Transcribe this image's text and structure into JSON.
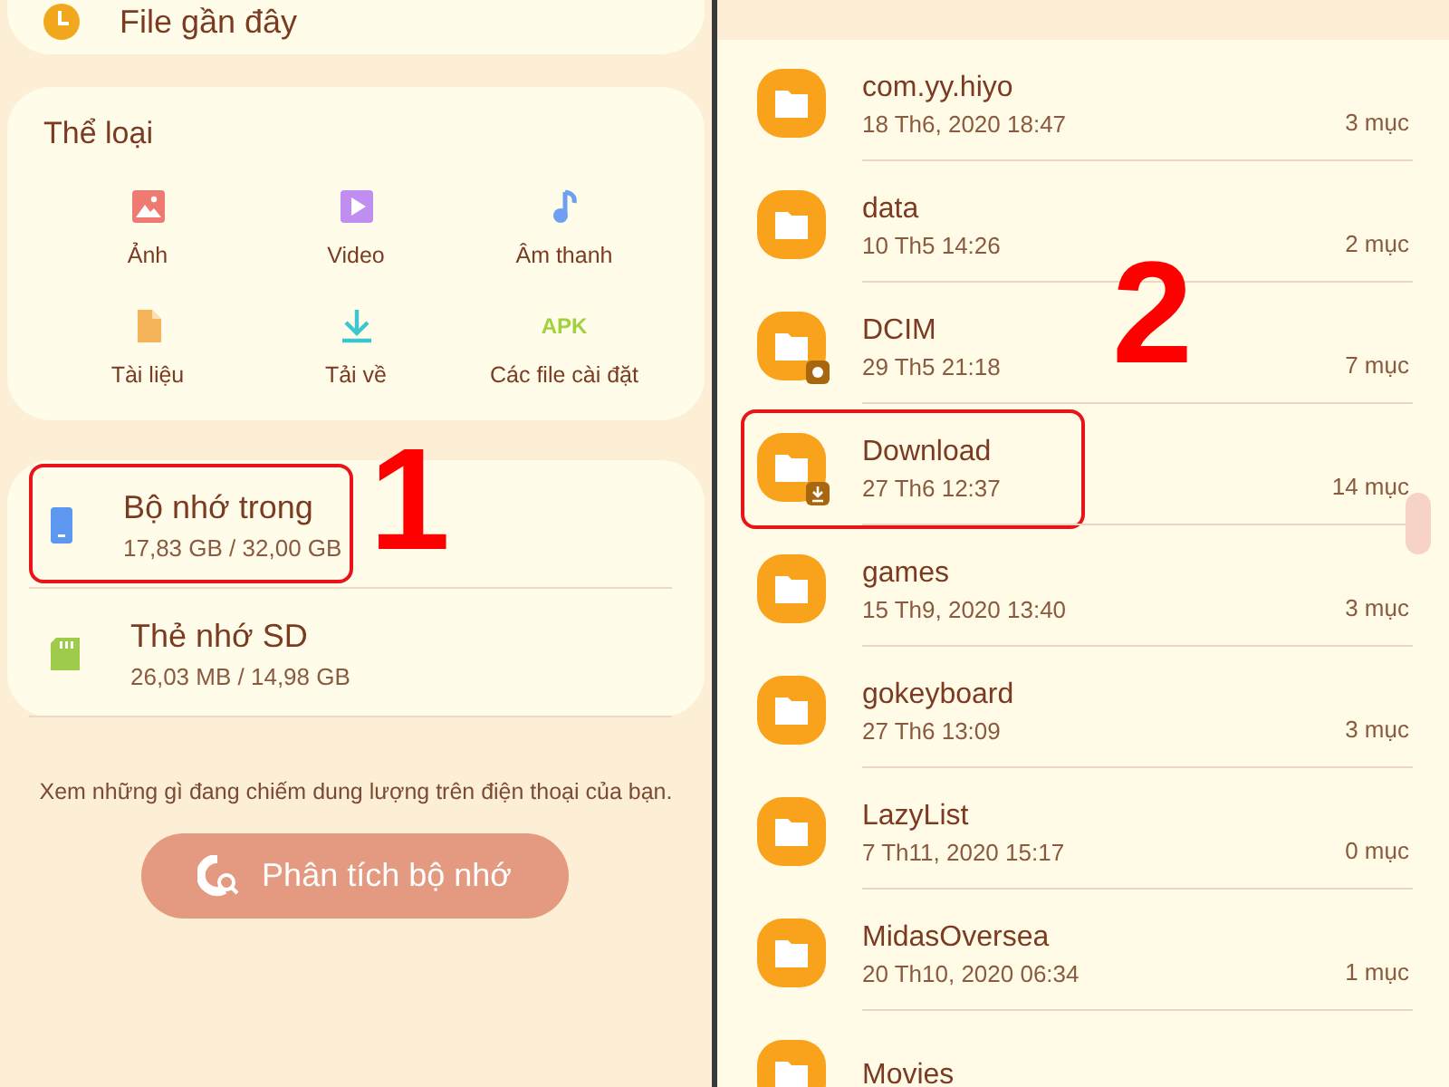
{
  "recent": {
    "label": "File gần đây"
  },
  "categories": {
    "title": "Thể loại",
    "items": [
      {
        "label": "Ảnh",
        "kind": "image"
      },
      {
        "label": "Video",
        "kind": "video"
      },
      {
        "label": "Âm thanh",
        "kind": "audio"
      },
      {
        "label": "Tài liệu",
        "kind": "document"
      },
      {
        "label": "Tải về",
        "kind": "download"
      },
      {
        "label": "Các file cài đặt",
        "kind": "apk",
        "icon_text": "APK"
      }
    ]
  },
  "storage": [
    {
      "name": "Bộ nhớ trong",
      "usage": "17,83 GB / 32,00 GB",
      "kind": "internal",
      "highlighted": true,
      "callout": "1"
    },
    {
      "name": "Thẻ nhớ SD",
      "usage": "26,03 MB / 14,98 GB",
      "kind": "sd",
      "highlighted": false
    }
  ],
  "hint": "Xem những gì đang chiếm dung lượng trên điện thoại của bạn.",
  "analyze_button": "Phân tích bộ nhớ",
  "folders": [
    {
      "name": "com.yy.hiyo",
      "date": "18 Th6, 2020 18:47",
      "count": "3 mục",
      "highlighted": false
    },
    {
      "name": "data",
      "date": "10 Th5 14:26",
      "count": "2 mục",
      "highlighted": false
    },
    {
      "name": "DCIM",
      "date": "29 Th5 21:18",
      "count": "7 mục",
      "kind": "camera",
      "highlighted": false
    },
    {
      "name": "Download",
      "date": "27 Th6 12:37",
      "count": "14 mục",
      "kind": "download",
      "highlighted": true,
      "callout": "2"
    },
    {
      "name": "games",
      "date": "15 Th9, 2020 13:40",
      "count": "3 mục",
      "highlighted": false
    },
    {
      "name": "gokeyboard",
      "date": "27 Th6 13:09",
      "count": "3 mục",
      "highlighted": false
    },
    {
      "name": "LazyList",
      "date": "7 Th11, 2020 15:17",
      "count": "0 mục",
      "highlighted": false
    },
    {
      "name": "MidasOversea",
      "date": "20 Th10, 2020 06:34",
      "count": "1 mục",
      "highlighted": false
    },
    {
      "name": "Movies",
      "highlighted": false
    }
  ]
}
